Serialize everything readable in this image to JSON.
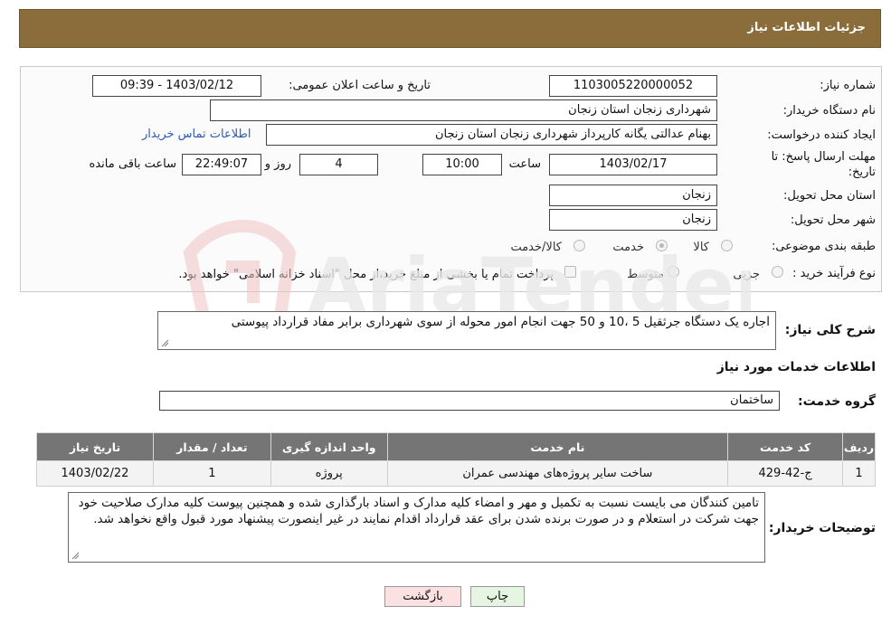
{
  "header": {
    "title": "جزئیات اطلاعات نیاز"
  },
  "form": {
    "need_number_label": "شماره نیاز:",
    "need_number": "1103005220000052",
    "announce_label": "تاریخ و ساعت اعلان عمومی:",
    "announce_value": "1403/02/12 - 09:39",
    "buyer_org_label": "نام دستگاه خریدار:",
    "buyer_org": "شهرداری زنجان استان زنجان",
    "creator_label": "ایجاد کننده درخواست:",
    "creator": "بهنام عدالتی یگانه کارپرداز شهرداری زنجان استان زنجان",
    "contact_link": "اطلاعات تماس خریدار",
    "deadline_label_1": "مهلت ارسال پاسخ: تا",
    "deadline_label_2": "تاریخ:",
    "deadline_date": "1403/02/17",
    "time_label": "ساعت",
    "deadline_time": "10:00",
    "days_value": "4",
    "days_label": "روز و",
    "remaining_time": "22:49:07",
    "remaining_label": "ساعت باقی مانده",
    "province_label": "استان محل تحویل:",
    "province": "زنجان",
    "city_label": "شهر محل تحویل:",
    "city": "زنجان",
    "category_label": "طبقه بندی موضوعی:",
    "category_options": [
      "کالا",
      "خدمت",
      "کالا/خدمت"
    ],
    "category_selected": "خدمت",
    "process_label": "نوع فرآیند خرید :",
    "process_options": [
      "جزیی",
      "متوسط"
    ],
    "process_note": "پرداخت تمام یا بخشی از مبلغ خرید،از محل \"اسناد خزانه اسلامی\" خواهد بود."
  },
  "watermark": {
    "text": "AriaTender.neT"
  },
  "summary": {
    "label": "شرح کلی نیاز:",
    "text": "اجاره یک دستگاه جرثقیل 5 ،10 و 50 جهت انجام امور محوله از سوی شهرداری برابر مفاد قرارداد پیوستی"
  },
  "services": {
    "section_title": "اطلاعات خدمات مورد نیاز",
    "group_label": "گروه خدمت:",
    "group_value": "ساختمان",
    "columns": [
      "ردیف",
      "کد خدمت",
      "نام خدمت",
      "واحد اندازه گیری",
      "تعداد / مقدار",
      "تاریخ نیاز"
    ],
    "rows": [
      [
        "1",
        "ج-42-429",
        "ساخت سایر پروژه‌های مهندسی عمران",
        "پروژه",
        "1",
        "1403/02/22"
      ]
    ]
  },
  "buyer_notes": {
    "label": "توضیحات خریدار:",
    "text": "تامین کنندگان می بایست نسبت به تکمیل و مهر و امضاء کلیه مدارک و اسناد بارگذاری شده و همچنین پیوست کلیه مدارک صلاحیت خود جهت شرکت در استعلام و در صورت برنده شدن برای عقد قرارداد اقدام نمایند در غیر اینصورت پیشنهاد مورد قبول واقع نخواهد شد."
  },
  "actions": {
    "print": "چاپ",
    "back": "بازگشت"
  }
}
